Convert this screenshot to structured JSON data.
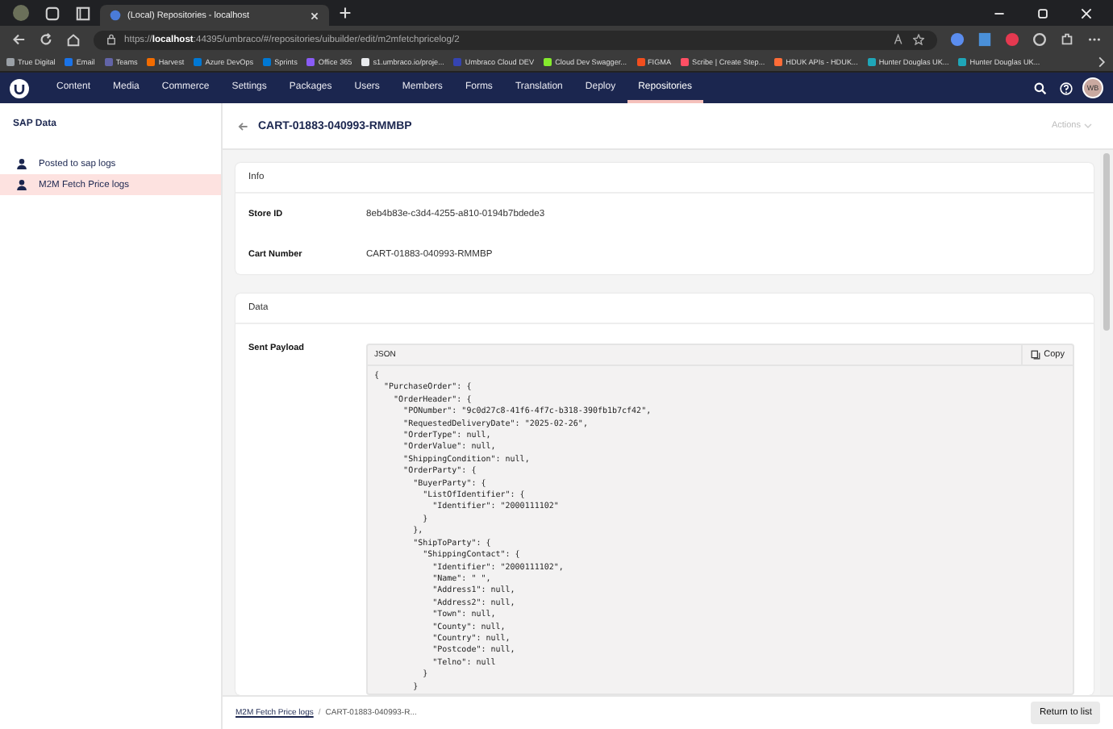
{
  "browser": {
    "tab_title": "(Local) Repositories - localhost",
    "url_prefix": "https://",
    "url_host": "localhost",
    "url_rest": ":44395/umbraco/#/repositories/uibuilder/edit/m2mfetchpricelog/2",
    "bookmarks": [
      {
        "label": "True Digital",
        "color": "#9aa0a6"
      },
      {
        "label": "Email",
        "color": "#1a73e8"
      },
      {
        "label": "Teams",
        "color": "#6264a7"
      },
      {
        "label": "Harvest",
        "color": "#f36c00"
      },
      {
        "label": "Azure DevOps",
        "color": "#0078d4"
      },
      {
        "label": "Sprints",
        "color": "#0078d4"
      },
      {
        "label": "Office 365",
        "color": "#8a5cf6"
      },
      {
        "label": "s1.umbraco.io/proje...",
        "color": "#e8eaed"
      },
      {
        "label": "Umbraco Cloud DEV",
        "color": "#3544b1"
      },
      {
        "label": "Cloud Dev Swagger...",
        "color": "#85ea2d"
      },
      {
        "label": "FIGMA",
        "color": "#f24e1e"
      },
      {
        "label": "Scribe | Create Step...",
        "color": "#ff4f64"
      },
      {
        "label": "HDUK APIs - HDUK...",
        "color": "#ff6c37"
      },
      {
        "label": "Hunter Douglas UK...",
        "color": "#1fa6b8"
      },
      {
        "label": "Hunter Douglas UK...",
        "color": "#1fa6b8"
      }
    ]
  },
  "nav": {
    "items": [
      {
        "label": "Content",
        "selected": false
      },
      {
        "label": "Media",
        "selected": false
      },
      {
        "label": "Commerce",
        "selected": false
      },
      {
        "label": "Settings",
        "selected": false
      },
      {
        "label": "Packages",
        "selected": false
      },
      {
        "label": "Users",
        "selected": false
      },
      {
        "label": "Members",
        "selected": false
      },
      {
        "label": "Forms",
        "selected": false
      },
      {
        "label": "Translation",
        "selected": false
      },
      {
        "label": "Deploy",
        "selected": false
      },
      {
        "label": "Repositories",
        "selected": true
      }
    ],
    "avatar": "WB"
  },
  "sidebar": {
    "title": "SAP Data",
    "items": [
      {
        "label": "Posted to sap logs",
        "selected": false
      },
      {
        "label": "M2M Fetch Price logs",
        "selected": true
      }
    ]
  },
  "header": {
    "title": "CART-01883-040993-RMMBP",
    "actions": "Actions"
  },
  "info": {
    "title": "Info",
    "fields": [
      {
        "label": "Store ID",
        "value": "8eb4b83e-c3d4-4255-a810-0194b7bdede3"
      },
      {
        "label": "Cart Number",
        "value": "CART-01883-040993-RMMBP"
      }
    ]
  },
  "data": {
    "title": "Data",
    "payload_label": "Sent Payload",
    "code_language": "JSON",
    "copy": "Copy",
    "code_lines": [
      "{",
      "  \"PurchaseOrder\": {",
      "    \"OrderHeader\": {",
      "      \"PONumber\": \"9c0d27c8-41f6-4f7c-b318-390fb1b7cf42\",",
      "      \"RequestedDeliveryDate\": \"2025-02-26\",",
      "      \"OrderType\": null,",
      "      \"OrderValue\": null,",
      "      \"ShippingCondition\": null,",
      "      \"OrderParty\": {",
      "        \"BuyerParty\": {",
      "          \"ListOfIdentifier\": {",
      "            \"Identifier\": \"2000111102\"",
      "          }",
      "        },",
      "        \"ShipToParty\": {",
      "          \"ShippingContact\": {",
      "            \"Identifier\": \"2000111102\",",
      "            \"Name\": \" \",",
      "            \"Address1\": null,",
      "            \"Address2\": null,",
      "            \"Town\": null,",
      "            \"County\": null,",
      "            \"Country\": null,",
      "            \"Postcode\": null,",
      "            \"Telno\": null",
      "          }",
      "        }"
    ]
  },
  "footer": {
    "breadcrumbs": [
      "M2M Fetch Price logs",
      "CART-01883-040993-R..."
    ],
    "separator": "/",
    "button": "Return to list"
  }
}
